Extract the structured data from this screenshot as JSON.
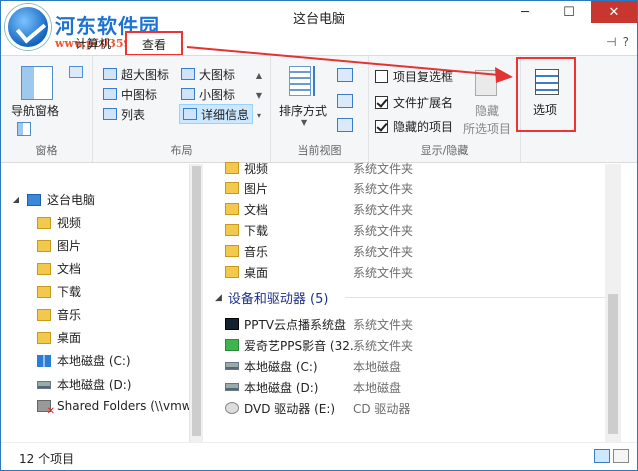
{
  "window": {
    "title": "这台电脑",
    "minimize": "─",
    "maximize": "☐",
    "close": "✕"
  },
  "watermark": {
    "title": "河东软件园",
    "url": "www.pc0359.cn"
  },
  "tabs": {
    "computer": "计算机",
    "view": "查看",
    "pin": "⊣",
    "help": "?"
  },
  "ribbon": {
    "panes": {
      "group_label": "窗格",
      "nav_pane": "导航窗格"
    },
    "layout": {
      "group_label": "布局",
      "items": [
        "超大图标",
        "大图标",
        "中图标",
        "小图标",
        "列表",
        "详细信息"
      ]
    },
    "current_view": {
      "group_label": "当前视图",
      "sort_by": "排序方式"
    },
    "show_hide": {
      "group_label": "显示/隐藏",
      "item_checkboxes": {
        "label": "项目复选框",
        "checked": false
      },
      "file_extensions": {
        "label": "文件扩展名",
        "checked": true
      },
      "hidden_items": {
        "label": "隐藏的项目",
        "checked": true
      },
      "hide_selected_1": "隐藏",
      "hide_selected_2": "所选项目"
    },
    "options": {
      "label": "选项"
    }
  },
  "nav": {
    "root": "这台电脑",
    "items": [
      "视频",
      "图片",
      "文档",
      "下载",
      "音乐",
      "桌面",
      "本地磁盘 (C:)",
      "本地磁盘 (D:)",
      "Shared Folders (\\\\vmw"
    ]
  },
  "content": {
    "folders": [
      {
        "name": "视频",
        "type": "系统文件夹"
      },
      {
        "name": "图片",
        "type": "系统文件夹"
      },
      {
        "name": "文档",
        "type": "系统文件夹"
      },
      {
        "name": "下载",
        "type": "系统文件夹"
      },
      {
        "name": "音乐",
        "type": "系统文件夹"
      },
      {
        "name": "桌面",
        "type": "系统文件夹"
      }
    ],
    "devices_header": "设备和驱动器 (5)",
    "devices": [
      {
        "name": "PPTV云点播系统盘",
        "type": "系统文件夹"
      },
      {
        "name": "爱奇艺PPS影音 (32...",
        "type": "系统文件夹"
      },
      {
        "name": "本地磁盘 (C:)",
        "type": "本地磁盘"
      },
      {
        "name": "本地磁盘 (D:)",
        "type": "本地磁盘"
      },
      {
        "name": "DVD 驱动器 (E:)",
        "type": "CD 驱动器"
      }
    ]
  },
  "status": {
    "count": "12 个项目"
  },
  "colors": {
    "accent": "#2b79c2",
    "highlight_red": "#e33333",
    "close_red": "#c7372f"
  }
}
